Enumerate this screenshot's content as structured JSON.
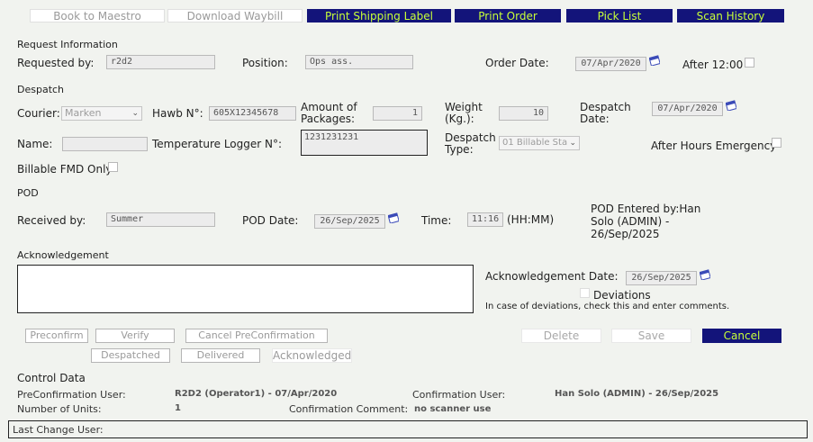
{
  "toolbar": {
    "book_to_maestro": "Book to Maestro",
    "download_waybill": "Download Waybill",
    "print_shipping_label": "Print Shipping Label",
    "print_order": "Print Order",
    "pick_list": "Pick List",
    "scan_history": "Scan History"
  },
  "request": {
    "section": "Request Information",
    "requested_by_label": "Requested by:",
    "requested_by_value": "r2d2",
    "position_label": "Position:",
    "position_value": "Ops ass.",
    "order_date_label": "Order Date:",
    "order_date_value": "07/Apr/2020",
    "after_12_label": "After 12:00"
  },
  "despatch": {
    "section": "Despatch",
    "courier_label": "Courier:",
    "courier_value": "Marken",
    "hawb_label": "Hawb N°:",
    "hawb_value": "605X12345678",
    "packages_label_1": "Amount of",
    "packages_label_2": "Packages:",
    "packages_value": "1",
    "weight_label_1": "Weight",
    "weight_label_2": "(Kg.):",
    "weight_value": "10",
    "despatch_date_label_1": "Despatch",
    "despatch_date_label_2": "Date:",
    "despatch_date_value": "07/Apr/2020",
    "name_label": "Name:",
    "name_value": "",
    "temp_logger_label": "Temperature Logger N°:",
    "temp_logger_value": "1231231231",
    "despatch_type_label_1": "Despatch",
    "despatch_type_label_2": "Type:",
    "despatch_type_value": "01 Billable Sta",
    "after_hours_label": "After Hours Emergency",
    "billable_fmd_label": "Billable FMD Only"
  },
  "pod": {
    "section": "POD",
    "received_by_label": "Received by:",
    "received_by_value": "Summer",
    "pod_date_label": "POD Date:",
    "pod_date_value": "26/Sep/2025",
    "time_label": "Time:",
    "time_value": "11:16",
    "time_format": "(HH:MM)",
    "entered_by_1": "POD Entered by:Han",
    "entered_by_2": "Solo (ADMIN) -",
    "entered_by_3": "26/Sep/2025"
  },
  "ack": {
    "section": "Acknowledgement",
    "text": "",
    "date_label": "Acknowledgement Date:",
    "date_value": "26/Sep/2025",
    "deviations_label": "Deviations",
    "deviations_help": "In case of deviations, check this and enter comments."
  },
  "actions": {
    "preconfirm": "Preconfirm",
    "verify": "Verify",
    "cancel_preconfirmation": "Cancel PreConfirmation",
    "despatched": "Despatched",
    "delivered": "Delivered",
    "acknowledged": "Acknowledged",
    "delete": "Delete",
    "save": "Save",
    "cancel": "Cancel"
  },
  "control": {
    "section": "Control Data",
    "preconfirmation_user_label": "PreConfirmation User:",
    "preconfirmation_user_value": "R2D2 (Operator1) - 07/Apr/2020",
    "confirmation_user_label": "Confirmation User:",
    "confirmation_user_value": "Han Solo (ADMIN) - 26/Sep/2025",
    "units_label": "Number of Units:",
    "units_value": "1",
    "confirmation_comment_label": "Confirmation Comment:",
    "confirmation_comment_value": "no scanner use",
    "last_change_label": "Last Change User:"
  },
  "colors": {
    "accent_bg": "#13147a",
    "accent_text": "#c7ff38",
    "page_bg": "#f1f3ef"
  }
}
